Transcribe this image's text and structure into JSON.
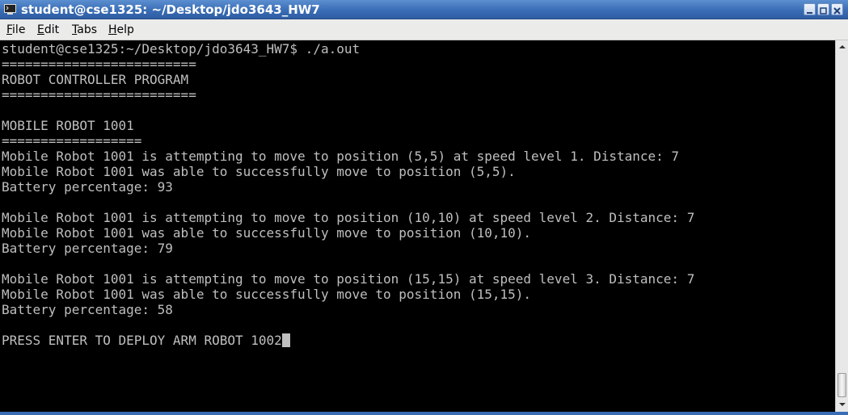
{
  "window": {
    "title": "student@cse1325: ~/Desktop/jdo3643_HW7",
    "app_icon": "terminal-icon"
  },
  "window_buttons": {
    "minimize": "minimize-icon",
    "maximize": "maximize-icon",
    "close": "close-icon"
  },
  "menu": [
    {
      "label": "File",
      "mnemonic": "F"
    },
    {
      "label": "Edit",
      "mnemonic": "E"
    },
    {
      "label": "Tabs",
      "mnemonic": "T"
    },
    {
      "label": "Help",
      "mnemonic": "H"
    }
  ],
  "terminal": {
    "lines": [
      "student@cse1325:~/Desktop/jdo3643_HW7$ ./a.out",
      "=========================",
      "ROBOT CONTROLLER PROGRAM",
      "=========================",
      "",
      "MOBILE ROBOT 1001",
      "==================",
      "Mobile Robot 1001 is attempting to move to position (5,5) at speed level 1. Distance: 7",
      "Mobile Robot 1001 was able to successfully move to position (5,5).",
      "Battery percentage: 93",
      "",
      "Mobile Robot 1001 is attempting to move to position (10,10) at speed level 2. Distance: 7",
      "Mobile Robot 1001 was able to successfully move to position (10,10).",
      "Battery percentage: 79",
      "",
      "Mobile Robot 1001 is attempting to move to position (15,15) at speed level 3. Distance: 7",
      "Mobile Robot 1001 was able to successfully move to position (15,15).",
      "Battery percentage: 58",
      "",
      "PRESS ENTER TO DEPLOY ARM ROBOT 1002"
    ],
    "foreground": "#bfbfbf",
    "background": "#000000"
  },
  "scrollbar": {
    "position": 1.0
  }
}
